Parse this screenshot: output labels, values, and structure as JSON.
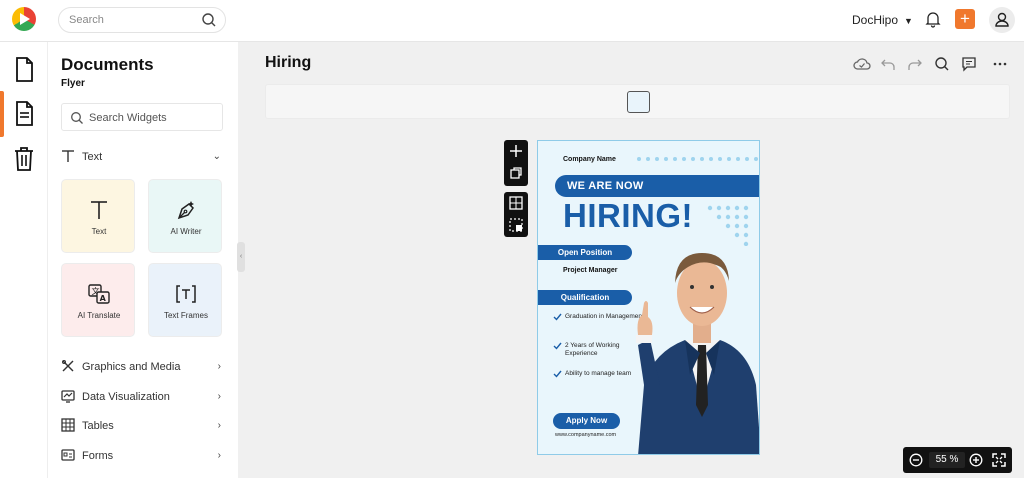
{
  "header": {
    "search_placeholder": "Search",
    "brand_label": "DocHipo",
    "accent_color": "#f0782d"
  },
  "rail": {
    "items": [
      "document-icon",
      "page-icon",
      "trash-icon"
    ]
  },
  "panel": {
    "title": "Documents",
    "subtitle": "Flyer",
    "search_placeholder": "Search Widgets",
    "text_section": "Text",
    "tiles": [
      {
        "label": "Text",
        "icon": "text-icon"
      },
      {
        "label": "AI Writer",
        "icon": "pen-icon"
      },
      {
        "label": "AI Translate",
        "icon": "translate-icon"
      },
      {
        "label": "Text Frames",
        "icon": "text-frame-icon"
      }
    ],
    "sections": [
      "Graphics and Media",
      "Data Visualization",
      "Tables",
      "Forms"
    ]
  },
  "canvas": {
    "doc_title": "Hiring",
    "zoom_value": "55",
    "zoom_unit": "%"
  },
  "flyer": {
    "company": "Company Name",
    "banner": "WE ARE NOW",
    "headline": "HIRING!",
    "open_position_label": "Open Position",
    "position": "Project Manager",
    "qualification_label": "Qualification",
    "qualifications": [
      "Graduation in Management",
      "2 Years of Working Experience",
      "Ability to manage team"
    ],
    "apply": "Apply Now",
    "url": "www.companyname.com",
    "brand_blue": "#1a5ea8"
  }
}
